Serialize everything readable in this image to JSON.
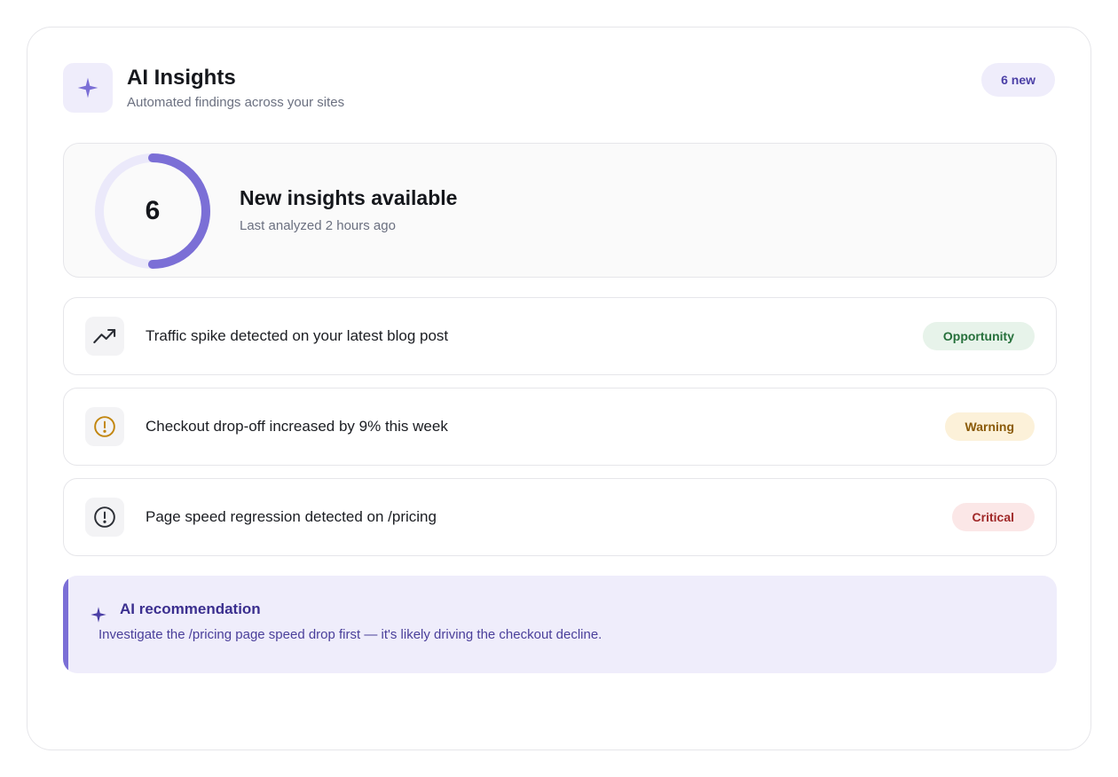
{
  "header": {
    "title": "AI Insights",
    "subtitle": "Automated findings across your sites",
    "badge": "6 new",
    "icon": "sparkle-icon"
  },
  "summary": {
    "count": "6",
    "title": "New insights available",
    "subtitle": "Last analyzed 2 hours ago",
    "ring_progress": 0.5,
    "ring_color": "#7b6fd6",
    "ring_track_color": "#ebe9fa"
  },
  "insights": [
    {
      "icon": "trending-up-icon",
      "text": "Traffic spike detected on your latest blog post",
      "tag": "Opportunity",
      "tag_kind": "opportunity"
    },
    {
      "icon": "alert-circle-icon",
      "text": "Checkout drop-off increased by 9% this week",
      "tag": "Warning",
      "tag_kind": "warning"
    },
    {
      "icon": "alert-circle-icon",
      "text": "Page speed regression detected on /pricing",
      "tag": "Critical",
      "tag_kind": "critical"
    }
  ],
  "recommendation": {
    "icon": "sparkle-icon",
    "title": "AI recommendation",
    "text": "Investigate the /pricing page speed drop first — it's likely driving the checkout decline."
  },
  "colors": {
    "accent": "#7b6fd6",
    "opportunity": "#26703b",
    "warning": "#c2860f",
    "critical": "#a02828"
  }
}
